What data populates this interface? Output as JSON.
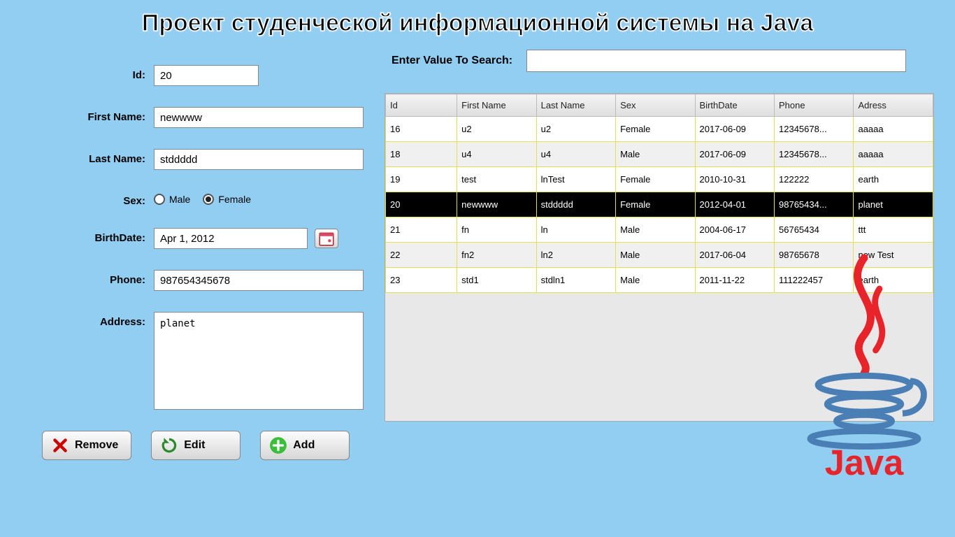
{
  "title": "Проект студенческой информационной системы на Java",
  "form": {
    "id_label": "Id:",
    "id_value": "20",
    "firstname_label": "First Name:",
    "firstname_value": "newwww",
    "lastname_label": "Last Name:",
    "lastname_value": "stddddd",
    "sex_label": "Sex:",
    "sex_male": "Male",
    "sex_female": "Female",
    "sex_selected": "Female",
    "birthdate_label": "BirthDate:",
    "birthdate_value": "Apr 1, 2012",
    "phone_label": "Phone:",
    "phone_value": "987654345678",
    "address_label": "Address:",
    "address_value": "planet"
  },
  "buttons": {
    "remove": "Remove",
    "edit": "Edit",
    "add": "Add"
  },
  "search": {
    "label": "Enter Value To Search:",
    "value": ""
  },
  "table": {
    "headers": [
      "Id",
      "First Name",
      "Last Name",
      "Sex",
      "BirthDate",
      "Phone",
      "Adress"
    ],
    "selected_id": "20",
    "rows": [
      {
        "id": "16",
        "fn": "u2",
        "ln": "u2",
        "sex": "Female",
        "bd": "2017-06-09",
        "ph": "12345678...",
        "ad": "aaaaa"
      },
      {
        "id": "18",
        "fn": "u4",
        "ln": "u4",
        "sex": "Male",
        "bd": "2017-06-09",
        "ph": "12345678...",
        "ad": "aaaaa"
      },
      {
        "id": "19",
        "fn": "test",
        "ln": "lnTest",
        "sex": "Female",
        "bd": "2010-10-31",
        "ph": "122222",
        "ad": "earth"
      },
      {
        "id": "20",
        "fn": "newwww",
        "ln": "stddddd",
        "sex": "Female",
        "bd": "2012-04-01",
        "ph": "98765434...",
        "ad": "planet"
      },
      {
        "id": "21",
        "fn": "fn",
        "ln": "ln",
        "sex": "Male",
        "bd": "2004-06-17",
        "ph": "56765434",
        "ad": "ttt"
      },
      {
        "id": "22",
        "fn": "fn2",
        "ln": "ln2",
        "sex": "Male",
        "bd": "2017-06-04",
        "ph": "98765678",
        "ad": "new Test"
      },
      {
        "id": "23",
        "fn": "std1",
        "ln": "stdln1",
        "sex": "Male",
        "bd": "2011-11-22",
        "ph": "111222457",
        "ad": "earth"
      }
    ]
  },
  "logo": {
    "name": "java-logo"
  }
}
